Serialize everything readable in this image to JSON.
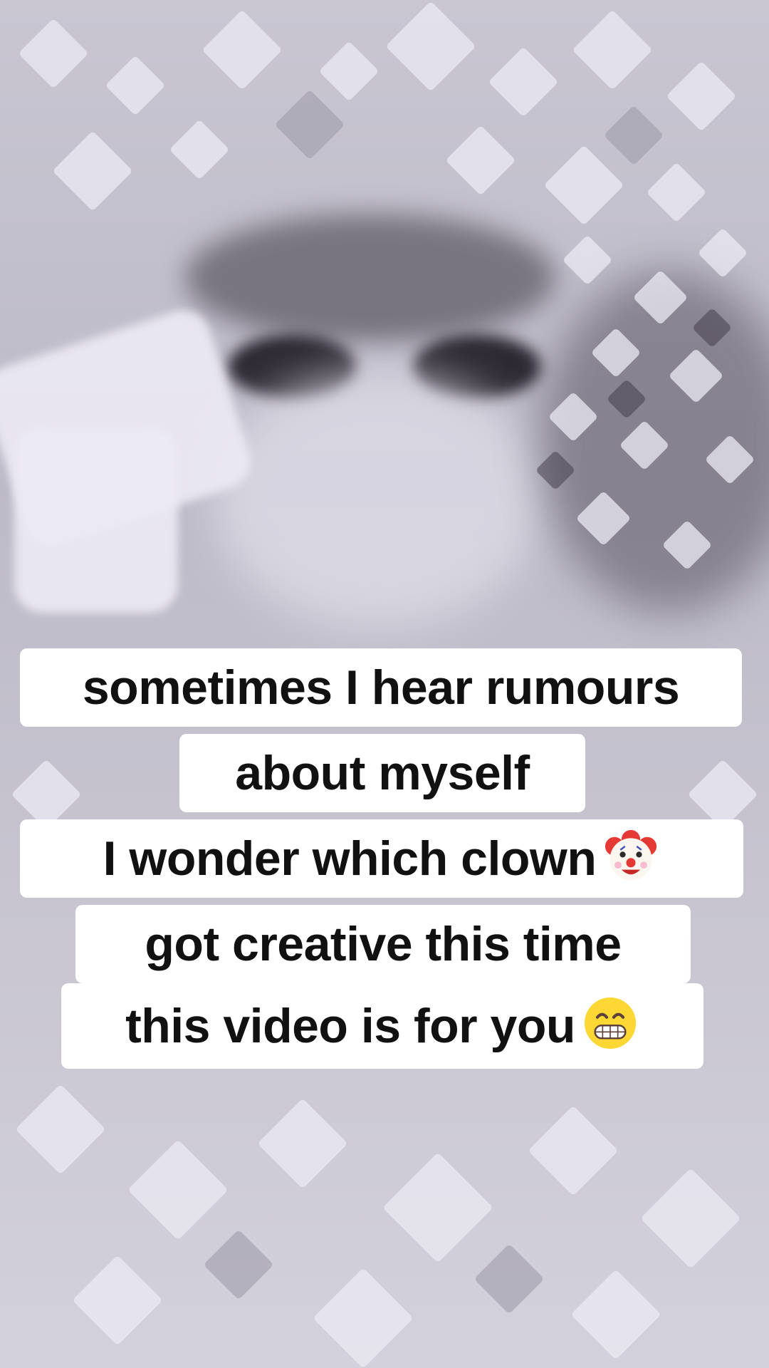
{
  "captions": {
    "line1": "sometimes I hear rumours",
    "line2": "about myself",
    "line3": "I wonder which clown",
    "line4": "got creative this time",
    "line5": "this video is for you"
  },
  "emojis": {
    "clown": "clown-face-icon",
    "grin": "grinning-face-icon"
  },
  "colors": {
    "caption_bg": "#ffffff",
    "caption_text": "#111111",
    "background_tint": "#c4c1ce"
  }
}
